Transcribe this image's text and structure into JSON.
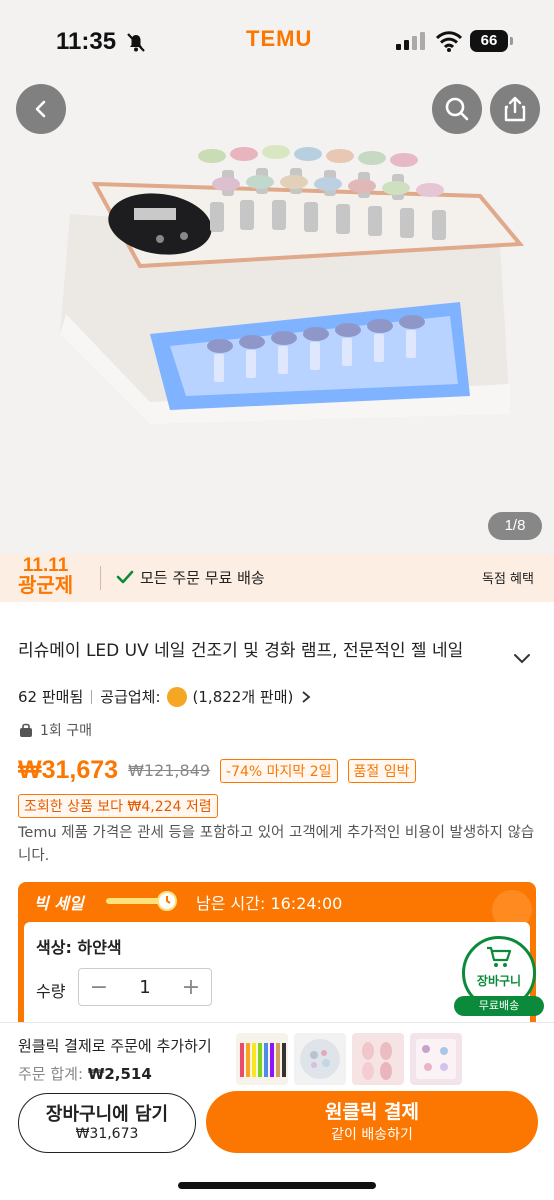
{
  "status_bar": {
    "time": "11:35",
    "app_logo": "TEMU",
    "battery": "66",
    "icons": [
      "bell-off-icon",
      "signal-icon",
      "wifi-icon",
      "battery-icon"
    ]
  },
  "gallery": {
    "counter": "1/8",
    "buttons": [
      "back-icon",
      "search-icon",
      "share-icon"
    ]
  },
  "promo": {
    "logo_line1": "11.11",
    "logo_line2": "광군제",
    "free_shipping": "모든 주문 무료 배송",
    "exclusive": "독점 혜택"
  },
  "product": {
    "title": "리슈메이 LED UV 네일 건조기 및 경화 램프, 전문적인 젤 네일",
    "sold": "62 판매됨",
    "supplier_label": "공급업체:",
    "supplier_sales": "(1,822개 판매)",
    "purchases": "1회 구매",
    "price": "₩31,673",
    "original_price": "₩121,849",
    "discount_tag": "-74% 마지막 2일",
    "stock_tag": "품절 임박",
    "cheaper_tag": "조회한 상품 보다 ₩4,224 저렴",
    "notice": "Temu 제품 가격은 관세 등을 포함하고 있어 고객에게 추가적인 비용이 발생하지 않습니다."
  },
  "sale": {
    "title": "빅 세일",
    "time_left": "남은 시간: 16:24:00",
    "color_label": "색상: 하얀색",
    "qty_label": "수량",
    "qty_value": "1",
    "minus": "−",
    "plus": "+"
  },
  "float_cart": {
    "label": "장바구니",
    "badge": "무료배송"
  },
  "bottom": {
    "oneclick_title": "원클릭 결제로 주문에 추가하기",
    "order_total_label": "주문 합계:",
    "order_total_value": "₩2,514",
    "add_cart_label": "장바구니에 담기",
    "add_cart_price": "₩31,673",
    "buy_label": "원클릭 결제",
    "buy_sub": "같이 배송하기"
  },
  "colors": {
    "accent": "#fb7701",
    "green": "#0a8a3a"
  }
}
